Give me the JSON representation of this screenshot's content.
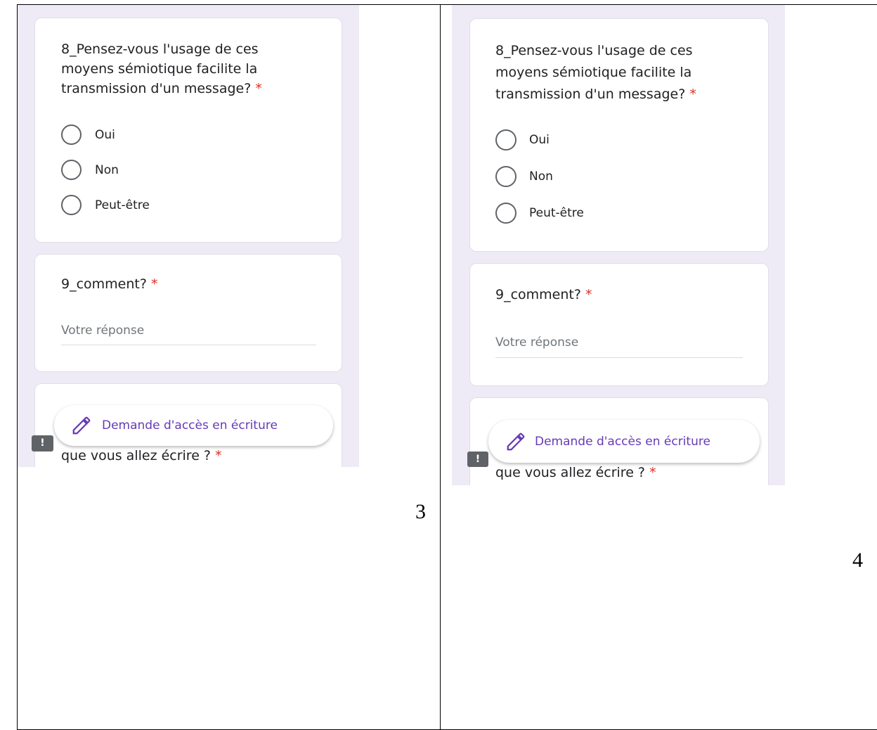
{
  "panels": [
    {
      "question8": {
        "text": "8_Pensez-vous l'usage de ces moyens sémiotique facilite la transmission d'un message?",
        "required_mark": "*"
      },
      "options": [
        "Oui",
        "Non",
        "Peut-être"
      ],
      "question9": {
        "text": "9_comment?",
        "required_mark": "*",
        "answer_placeholder": "Votre réponse"
      },
      "edit_access_button": "Demande d'accès en écriture",
      "feedback_icon": "!",
      "partial_question": {
        "text": "que vous allez écrire ?",
        "required_mark": "*"
      },
      "page_number": "3"
    },
    {
      "question8": {
        "text": "8_Pensez-vous l'usage de ces moyens sémiotique facilite la transmission d'un message?",
        "required_mark": "*"
      },
      "options": [
        "Oui",
        "Non",
        "Peut-être"
      ],
      "question9": {
        "text": "9_comment?",
        "required_mark": "*",
        "answer_placeholder": "Votre réponse"
      },
      "edit_access_button": "Demande d'accès en écriture",
      "feedback_icon": "!",
      "partial_question": {
        "text": "que vous allez écrire ?",
        "required_mark": "*"
      },
      "page_number": "4"
    }
  ],
  "colors": {
    "form_background": "#eeeaf6",
    "accent_purple": "#673ab7",
    "required_red": "#d93025"
  },
  "icons": {
    "edit": "pencil-icon",
    "feedback": "feedback-icon"
  }
}
